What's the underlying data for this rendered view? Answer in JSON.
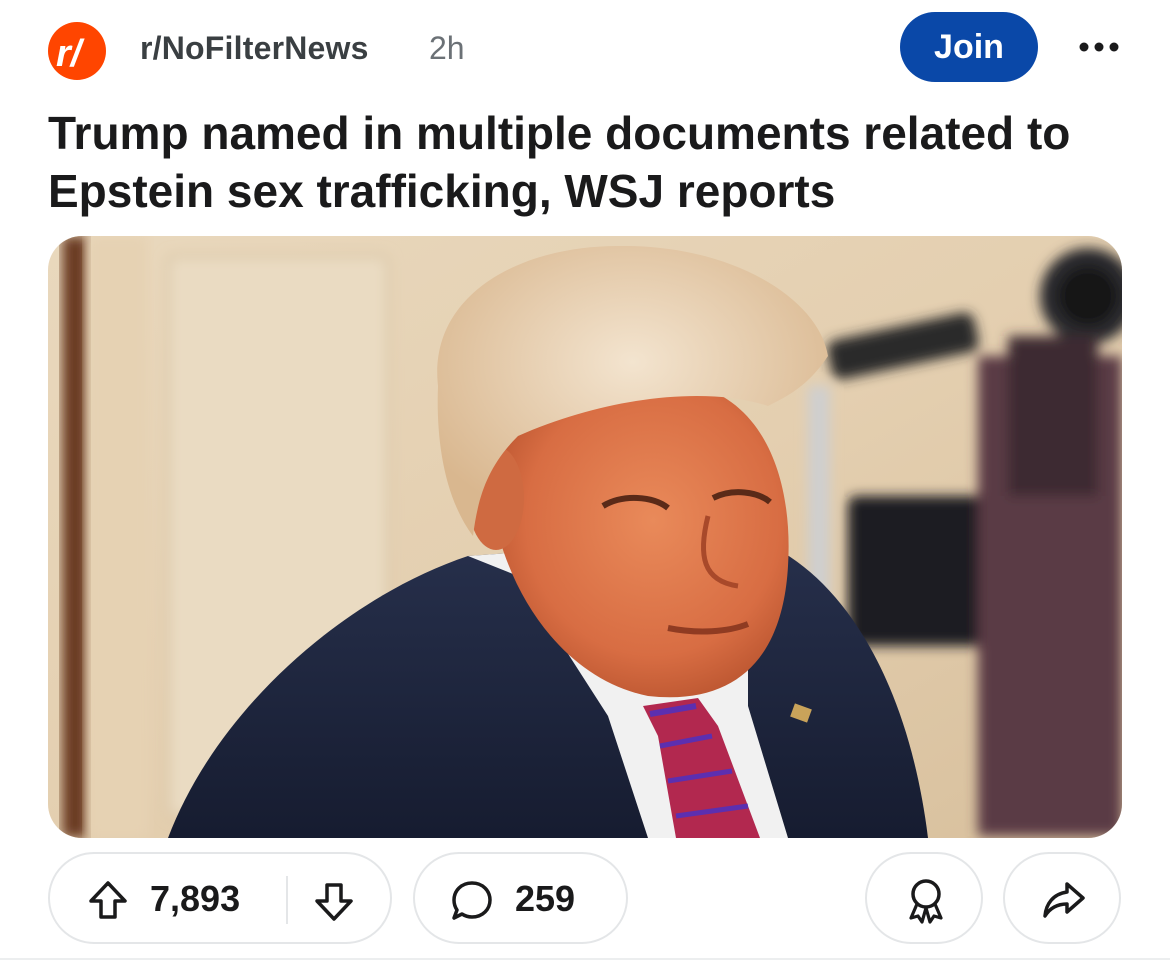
{
  "post": {
    "subreddit": "r/NoFilterNews",
    "subreddit_icon": "reddit-r-slash-icon",
    "age": "2h",
    "join_label": "Join",
    "title": "Trump named in multiple documents related to Epstein sex trafficking, WSJ reports",
    "image_alt": "Photo of Donald Trump in a navy suit, white shirt and red patterned tie, with a blurred camera and tripod in the background"
  },
  "actions": {
    "upvotes": "7,893",
    "comments": "259"
  },
  "icons": {
    "more": "more-dots-icon",
    "upvote": "upvote-arrow-icon",
    "downvote": "downvote-arrow-icon",
    "comment": "comment-bubble-icon",
    "award": "award-icon",
    "share": "share-arrow-icon"
  },
  "colors": {
    "brand": "#ff4500",
    "join_button": "#0a48a8",
    "pill_border": "#e4e6e8",
    "text": "#1a1a1b"
  }
}
